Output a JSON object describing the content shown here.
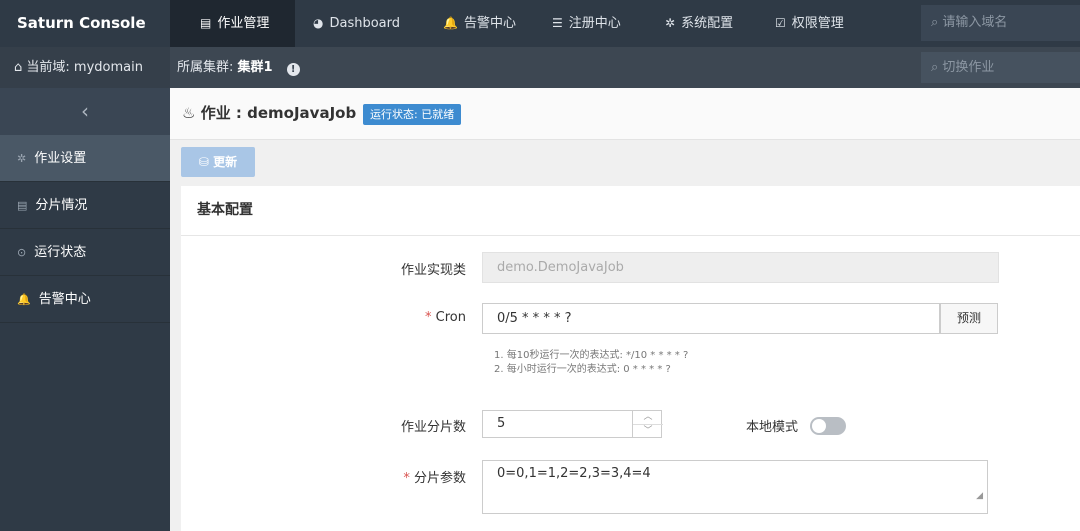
{
  "app": {
    "title": "Saturn Console"
  },
  "nav": {
    "items": [
      {
        "label": "作业管理",
        "icon": "list-icon",
        "active": true
      },
      {
        "label": "Dashboard",
        "icon": "pie-chart-icon"
      },
      {
        "label": "告警中心",
        "icon": "bell-icon"
      },
      {
        "label": "注册中心",
        "icon": "server-icon"
      },
      {
        "label": "系统配置",
        "icon": "gear-icon"
      },
      {
        "label": "权限管理",
        "icon": "checkbox-icon"
      }
    ],
    "search_placeholder": "请输入域名"
  },
  "subbar": {
    "domain_label": "当前域: mydomain",
    "cluster_prefix": "所属集群: ",
    "cluster_value": "集群1",
    "switch_placeholder": "切换作业"
  },
  "sidebar": {
    "items": [
      {
        "label": "作业设置",
        "icon": "gear-icon",
        "active": true
      },
      {
        "label": "分片情况",
        "icon": "list-icon"
      },
      {
        "label": "运行状态",
        "icon": "circle-dot-icon"
      },
      {
        "label": "告警中心",
        "icon": "bell-icon"
      }
    ]
  },
  "job": {
    "title": "作业 : demoJavaJob",
    "status_badge": "运行状态: 已就绪",
    "update_button": "更新"
  },
  "form": {
    "section_title": "基本配置",
    "impl_class_label": "作业实现类",
    "impl_class_value": "demo.DemoJavaJob",
    "cron_label": "Cron",
    "cron_value": "0/5 * * * * ?",
    "predict_button": "预测",
    "hint_1": "1. 每10秒运行一次的表达式: */10 * * * * ?",
    "hint_2": "2. 每小时运行一次的表达式: 0 * * * * ?",
    "shard_count_label": "作业分片数",
    "shard_count_value": "5",
    "local_mode_label": "本地模式",
    "local_mode_on": false,
    "shard_params_label": "分片参数",
    "shard_params_value": "0=0,1=1,2=2,3=3,4=4"
  }
}
